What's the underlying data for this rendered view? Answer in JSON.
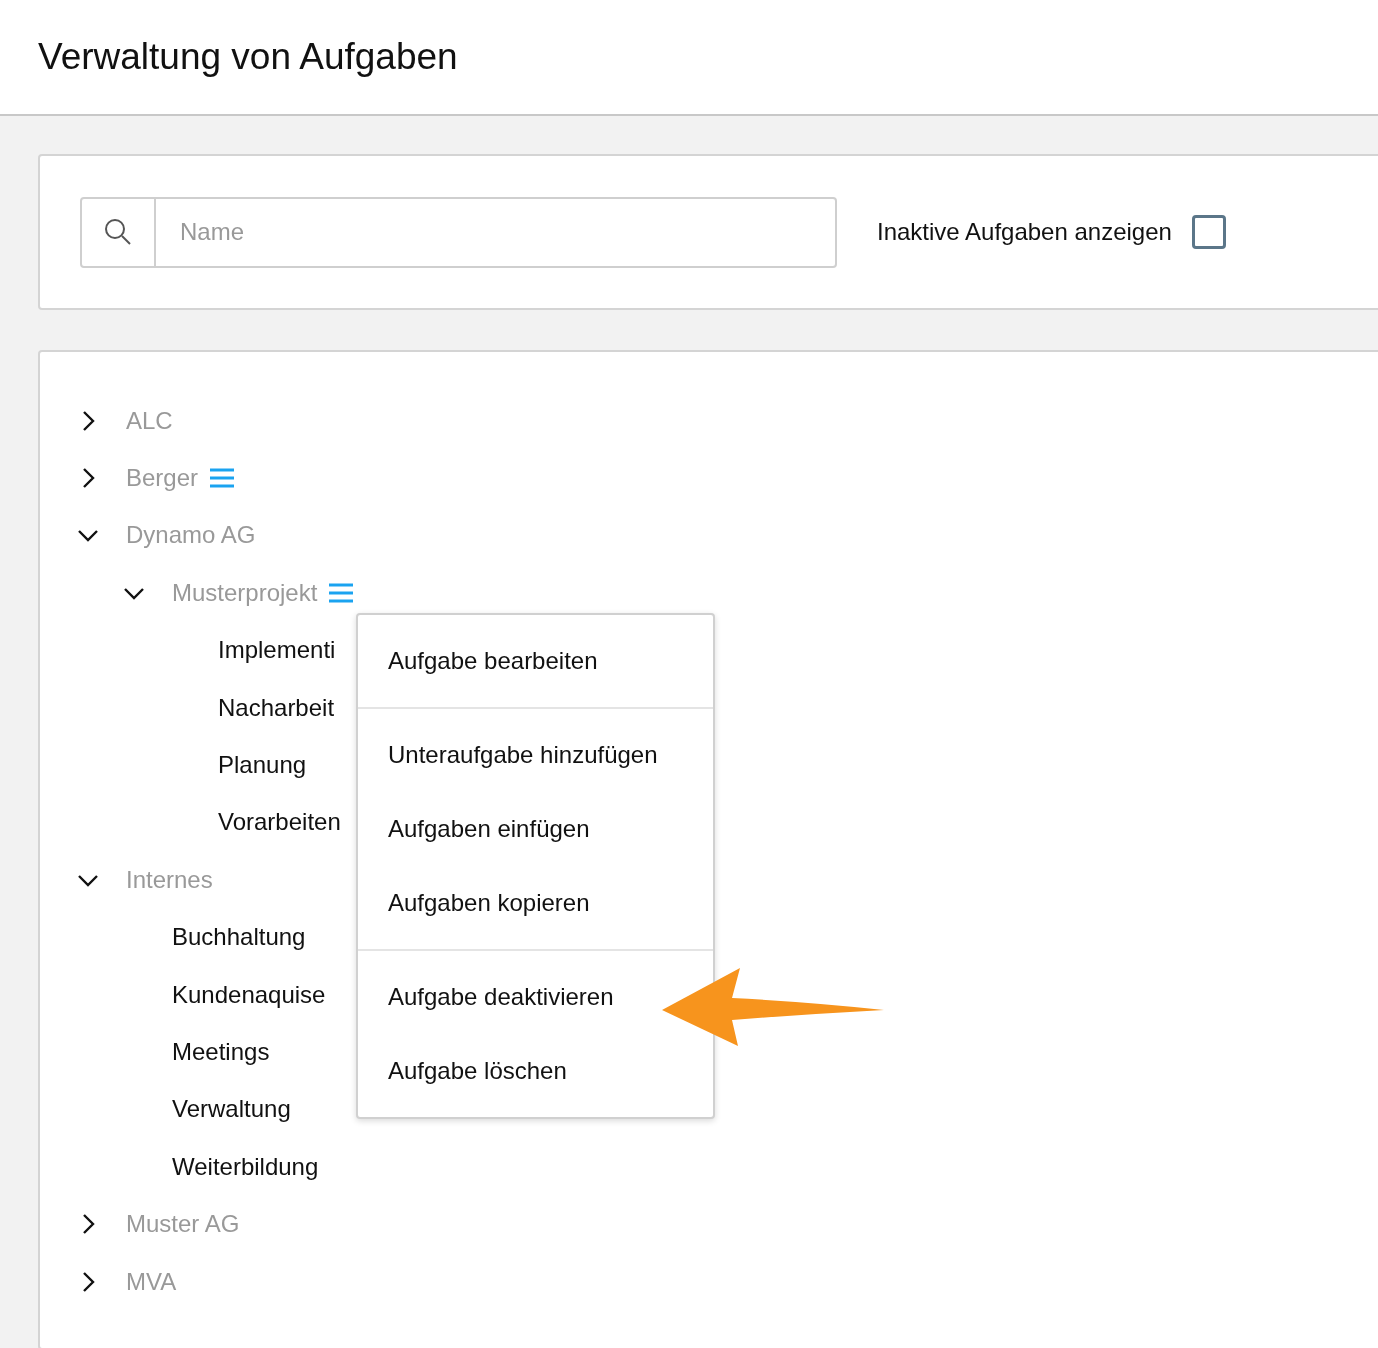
{
  "header": {
    "title": "Verwaltung von Aufgaben"
  },
  "filter": {
    "search": {
      "placeholder": "Name"
    },
    "inactive_toggle": {
      "label": "Inaktive Aufgaben anzeigen",
      "checked": false
    }
  },
  "tree": [
    {
      "kind": "group",
      "label": "ALC",
      "expanded": false,
      "menu_icon": false
    },
    {
      "kind": "group",
      "label": "Berger",
      "expanded": false,
      "menu_icon": true
    },
    {
      "kind": "group",
      "label": "Dynamo AG",
      "expanded": true,
      "menu_icon": false,
      "children": [
        {
          "kind": "group",
          "label": "Musterprojekt",
          "expanded": true,
          "menu_icon": true,
          "children": [
            {
              "kind": "task",
              "label": "Implementi"
            },
            {
              "kind": "task",
              "label": "Nacharbeit"
            },
            {
              "kind": "task",
              "label": "Planung"
            },
            {
              "kind": "task",
              "label": "Vorarbeiten"
            }
          ]
        }
      ]
    },
    {
      "kind": "group",
      "label": "Internes",
      "expanded": true,
      "menu_icon": false,
      "children": [
        {
          "kind": "task",
          "label": "Buchhaltung"
        },
        {
          "kind": "task",
          "label": "Kundenaquise"
        },
        {
          "kind": "task",
          "label": "Meetings"
        },
        {
          "kind": "task",
          "label": "Verwaltung"
        },
        {
          "kind": "task",
          "label": "Weiterbildung"
        }
      ]
    },
    {
      "kind": "group",
      "label": "Muster AG",
      "expanded": false,
      "menu_icon": false
    },
    {
      "kind": "group",
      "label": "MVA",
      "expanded": false,
      "menu_icon": false
    }
  ],
  "context_menu": {
    "sections": [
      [
        "Aufgabe bearbeiten"
      ],
      [
        "Unteraufgabe hinzufügen",
        "Aufgaben einfügen",
        "Aufgaben kopieren"
      ],
      [
        "Aufgabe deaktivieren",
        "Aufgabe löschen"
      ]
    ]
  }
}
